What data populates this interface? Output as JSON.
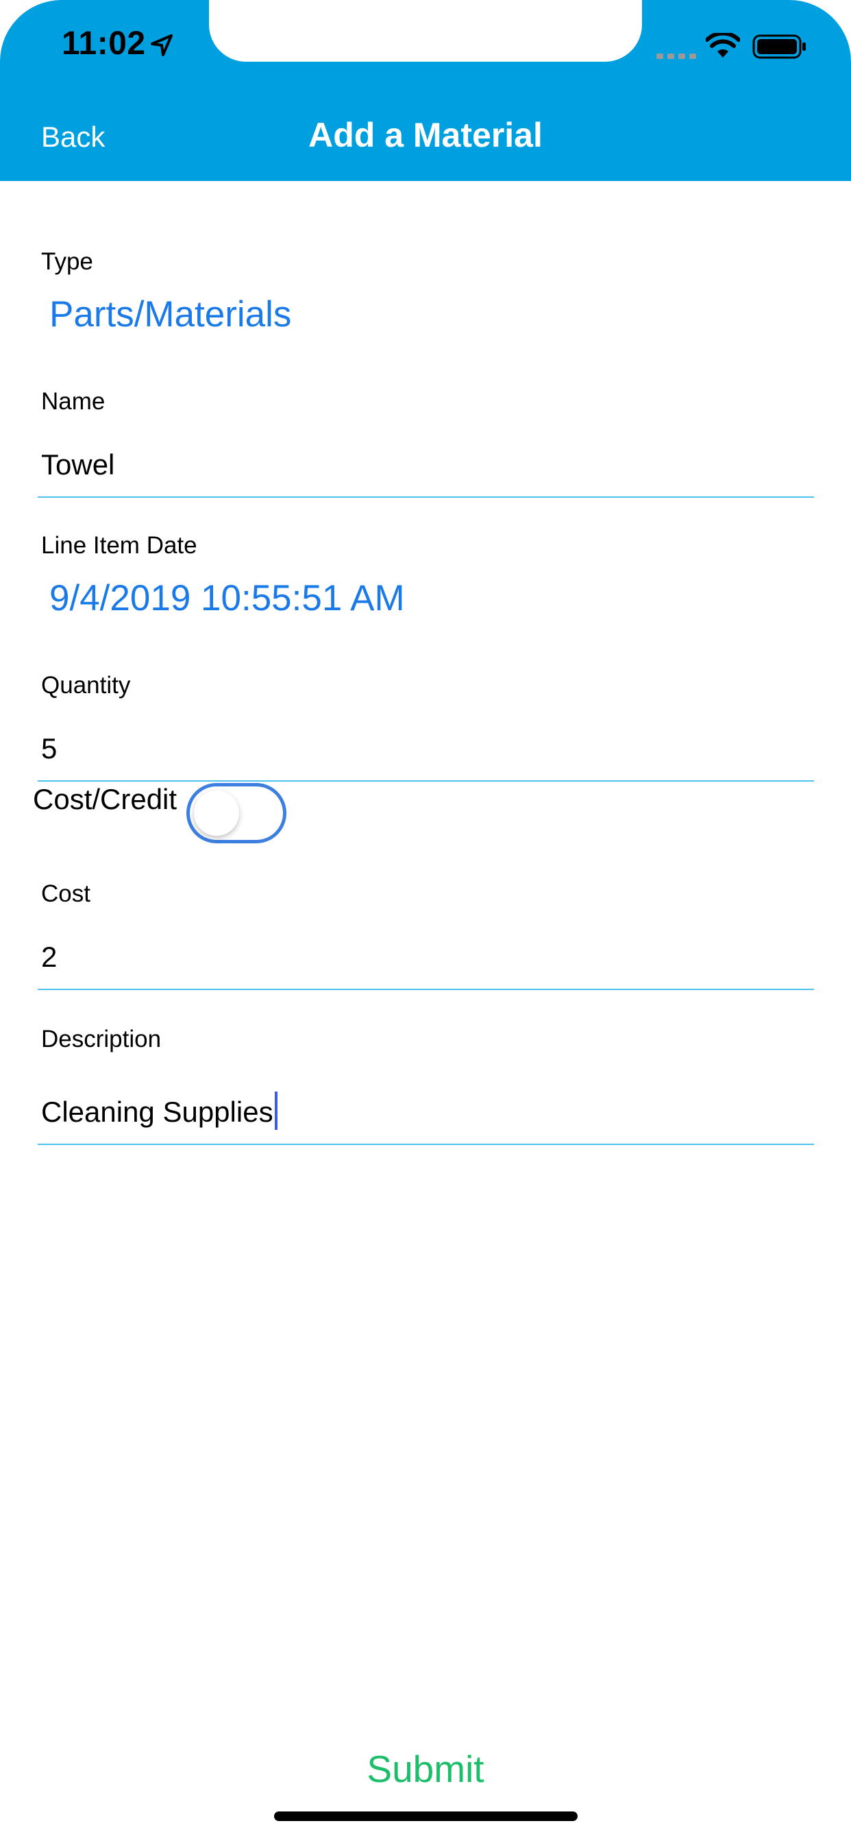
{
  "status_bar": {
    "time": "11:02"
  },
  "nav": {
    "back_label": "Back",
    "title": "Add a Material"
  },
  "form": {
    "type": {
      "label": "Type",
      "value": "Parts/Materials"
    },
    "name": {
      "label": "Name",
      "value": "Towel"
    },
    "line_item_date": {
      "label": "Line Item Date",
      "value": "9/4/2019 10:55:51 AM"
    },
    "quantity": {
      "label": "Quantity",
      "value": "5"
    },
    "cost_credit": {
      "label": "Cost/Credit",
      "on": false
    },
    "cost": {
      "label": "Cost",
      "value": "2"
    },
    "description": {
      "label": "Description",
      "value": "Cleaning Supplies"
    }
  },
  "submit_label": "Submit",
  "colors": {
    "header": "#00a0e0",
    "picker_text": "#1a7ae8",
    "entry_underline": "#4cc3ee",
    "toggle_border": "#3d7fe0",
    "submit": "#1dbe6a"
  }
}
